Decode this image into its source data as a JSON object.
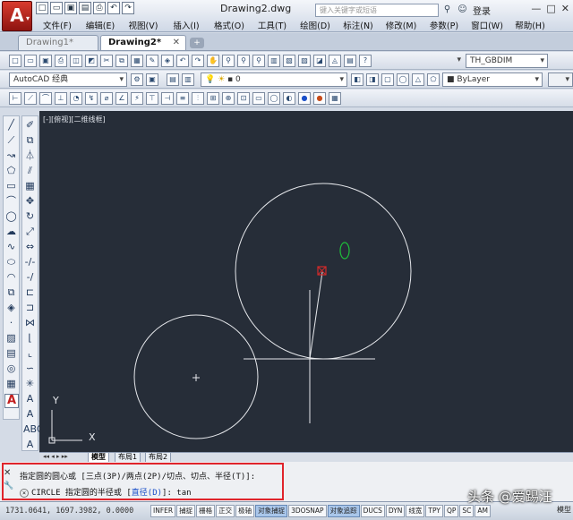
{
  "title_bar": {
    "app_letter": "A",
    "document_title": "Drawing2.dwg",
    "search_placeholder": "键入关键字或短语",
    "login_label": "登录",
    "window_controls": [
      "—",
      "□",
      "✕"
    ]
  },
  "menu": [
    "文件(F)",
    "编辑(E)",
    "视图(V)",
    "插入(I)",
    "格式(O)",
    "工具(T)",
    "绘图(D)",
    "标注(N)",
    "修改(M)",
    "参数(P)",
    "窗口(W)",
    "帮助(H)"
  ],
  "tabs": [
    {
      "label": "Drawing1*",
      "active": false
    },
    {
      "label": "Drawing2*",
      "active": true,
      "close": "✕"
    }
  ],
  "toolbar": {
    "dim_style": "TH_GBDIM",
    "workspace": "AutoCAD 经典",
    "layer": "0",
    "color": "ByLayer"
  },
  "viewport_label": "[-][俯视][二维线框]",
  "layout_tabs": [
    "模型",
    "布局1",
    "布局2"
  ],
  "command": {
    "line1": "指定圆的圆心或 [三点(3P)/两点(2P)/切点、切点、半径(T)]:",
    "line2_prefix": "CIRCLE 指定圆的半径或 [",
    "line2_option": "直径(D)",
    "line2_suffix": "]: tan",
    "side_icons": [
      "✕",
      "🔧"
    ]
  },
  "status": {
    "coords": "1731.0641, 1697.3982, 0.0000",
    "buttons": [
      {
        "label": "INFER",
        "on": false
      },
      {
        "label": "捕捉",
        "on": false
      },
      {
        "label": "栅格",
        "on": false
      },
      {
        "label": "正交",
        "on": false
      },
      {
        "label": "极轴",
        "on": false
      },
      {
        "label": "对象捕捉",
        "on": true
      },
      {
        "label": "3DOSNAP",
        "on": false
      },
      {
        "label": "对象追踪",
        "on": true
      },
      {
        "label": "DUCS",
        "on": false
      },
      {
        "label": "DYN",
        "on": false
      },
      {
        "label": "线宽",
        "on": false
      },
      {
        "label": "TPY",
        "on": false
      },
      {
        "label": "QP",
        "on": false
      },
      {
        "label": "SC",
        "on": false
      },
      {
        "label": "AM",
        "on": false
      }
    ],
    "right_label": "模型"
  },
  "watermark": "头条 @爱踢汪",
  "ucs": {
    "y_label": "Y",
    "x_label": "X"
  },
  "colors": {
    "canvas": "#262d38",
    "highlight": "#e0242b",
    "snap_marker": "#1fbf3a"
  }
}
